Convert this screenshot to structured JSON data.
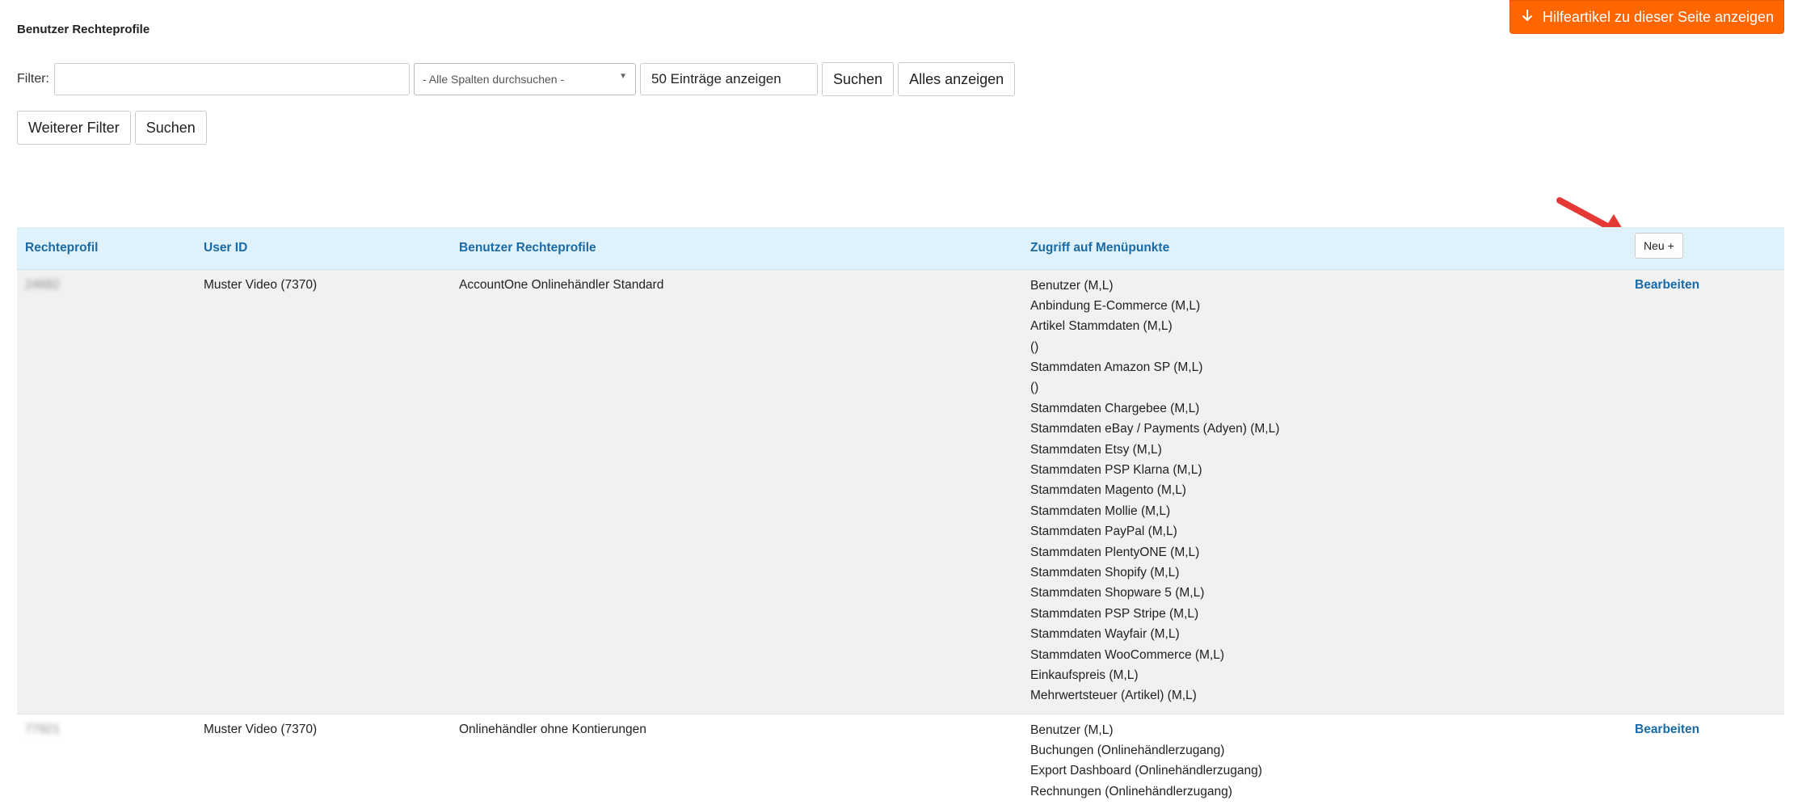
{
  "page": {
    "title": "Benutzer Rechteprofile"
  },
  "help": {
    "label": "Hilfeartikel zu dieser Seite anzeigen",
    "icon": "arrow-down-icon",
    "color": "#ff6600"
  },
  "filter": {
    "label": "Filter:",
    "input_value": "",
    "column_select": "- Alle Spalten durchsuchen -",
    "entries": "50 Einträge anzeigen",
    "search_label": "Suchen",
    "show_all_label": "Alles anzeigen",
    "more_filter_label": "Weiterer Filter",
    "search2_label": "Suchen"
  },
  "table": {
    "headers": [
      "Rechteprofil",
      "User ID",
      "Benutzer Rechteprofile",
      "Zugriff auf Menüpunkte"
    ],
    "new_label": "Neu +",
    "rows": [
      {
        "profile_id": "24682",
        "user_id": "Muster Video (7370)",
        "profile_name": "AccountOne Onlinehändler Standard",
        "menu": [
          "Benutzer (M,L)",
          "Anbindung E-Commerce (M,L)",
          "Artikel Stammdaten (M,L)",
          "()",
          "Stammdaten Amazon SP (M,L)",
          "()",
          "Stammdaten Chargebee (M,L)",
          "Stammdaten eBay / Payments (Adyen) (M,L)",
          "Stammdaten Etsy (M,L)",
          "Stammdaten PSP Klarna (M,L)",
          "Stammdaten Magento (M,L)",
          "Stammdaten Mollie (M,L)",
          "Stammdaten PayPal (M,L)",
          "Stammdaten PlentyONE (M,L)",
          "Stammdaten Shopify (M,L)",
          "Stammdaten Shopware 5 (M,L)",
          "Stammdaten PSP Stripe (M,L)",
          "Stammdaten Wayfair (M,L)",
          "Stammdaten WooCommerce (M,L)",
          "Einkaufspreis (M,L)",
          "Mehrwertsteuer (Artikel) (M,L)"
        ],
        "edit_label": "Bearbeiten"
      },
      {
        "profile_id": "77921",
        "user_id": "Muster Video (7370)",
        "profile_name": "Onlinehändler ohne Kontierungen",
        "menu": [
          "Benutzer (M,L)",
          "Buchungen (Onlinehändlerzugang)",
          "Export Dashboard (Onlinehändlerzugang)",
          "Rechnungen (Onlinehändlerzugang)"
        ],
        "edit_label": "Bearbeiten"
      }
    ]
  },
  "colors": {
    "header_bg": "#dff2fc",
    "link": "#1a6aa6",
    "arrow": "#e53935"
  }
}
